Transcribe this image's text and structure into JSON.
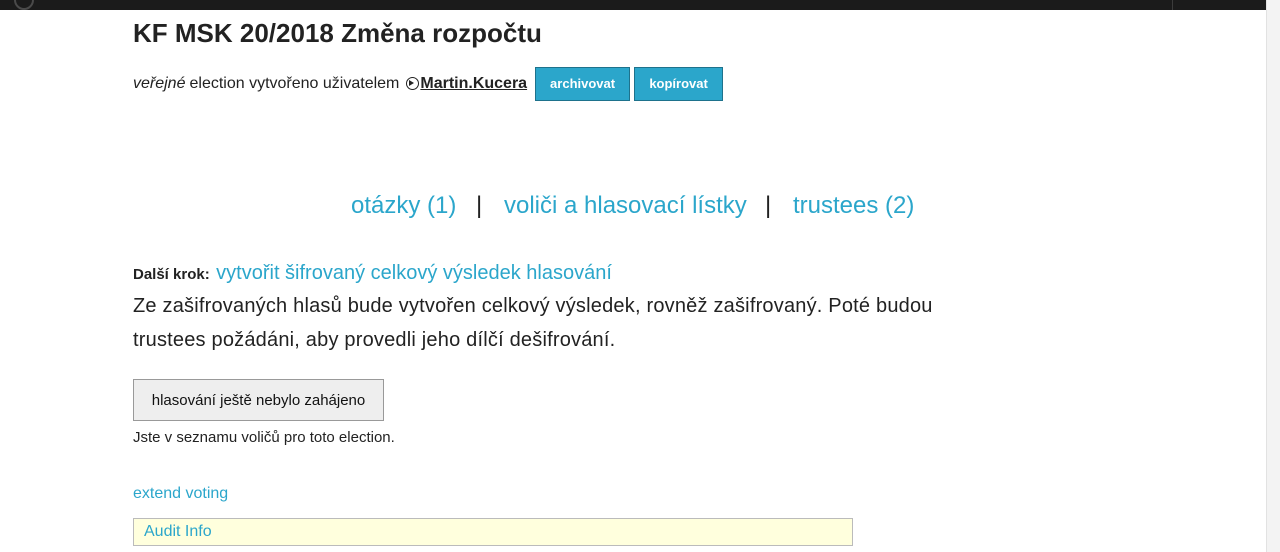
{
  "election": {
    "title": "KF MSK 20/2018 Změna rozpočtu",
    "visibility": "veřejné",
    "created_by_text": "election vytvořeno uživatelem",
    "creator": "Martin.Kucera",
    "archive_label": "archivovat",
    "copy_label": "kopírovat"
  },
  "nav": {
    "questions": "otázky (1)",
    "voters": "voliči a hlasovací lístky",
    "trustees": "trustees (2)",
    "separator": "|"
  },
  "next_step": {
    "label": "Další krok:",
    "action": "vytvořit šifrovaný celkový výsledek hlasování",
    "description": "Ze zašifrovaných hlasů bude vytvořen celkový výsledek, rovněž zašifrovaný. Poté budou trustees požádáni, aby provedli jeho dílčí dešifrování."
  },
  "voting": {
    "status_button": "hlasování ještě nebylo zahájeno",
    "voter_note": "Jste v seznamu voličů pro toto election.",
    "extend_link": "extend voting"
  },
  "audit": {
    "label": "Audit Info"
  },
  "colors": {
    "accent": "#2ba6cb",
    "audit_background": "#ffffdd",
    "topbar": "#1b1b1b"
  },
  "icons": {
    "creator": "user-icon"
  }
}
